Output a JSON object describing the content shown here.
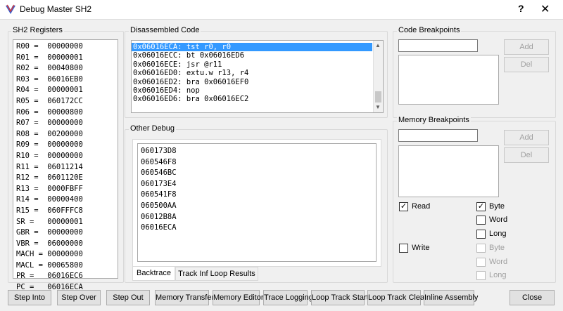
{
  "window": {
    "title": "Debug Master SH2",
    "help": "?",
    "close": "✕"
  },
  "registers": {
    "label": "SH2 Registers",
    "items": [
      "R00 =  00000000",
      "R01 =  00000001",
      "R02 =  00040800",
      "R03 =  06016EB0",
      "R04 =  00000001",
      "R05 =  060172CC",
      "R06 =  00000800",
      "R07 =  00000000",
      "R08 =  00200000",
      "R09 =  00000000",
      "R10 =  00000000",
      "R11 =  06011214",
      "R12 =  0601120E",
      "R13 =  0000FBFF",
      "R14 =  00000400",
      "R15 =  060FFFC8",
      "SR =   00000001",
      "GBR =  00000000",
      "VBR =  06000000",
      "MACH = 00000000",
      "MACL = 00065800",
      "PR =   06016EC6",
      "PC =   06016ECA"
    ]
  },
  "disassembly": {
    "label": "Disassembled Code",
    "lines": [
      "0x06016ECA: tst r0, r0",
      "0x06016ECC: bt 0x06016ED6",
      "0x06016ECE: jsr @r11",
      "0x06016ED0: extu.w r13, r4",
      "0x06016ED2: bra 0x06016EF0",
      "0x06016ED4: nop",
      "0x06016ED6: bra 0x06016EC2"
    ],
    "selected_index": 0
  },
  "code_breakpoints": {
    "label": "Code Breakpoints",
    "input_value": "",
    "add": "Add",
    "del": "Del"
  },
  "memory_breakpoints": {
    "label": "Memory Breakpoints",
    "input_value": "",
    "add": "Add",
    "del": "Del",
    "read": {
      "label": "Read",
      "checked": true
    },
    "write": {
      "label": "Write",
      "checked": false
    },
    "byte": {
      "label": "Byte",
      "checked": true
    },
    "word": {
      "label": "Word",
      "checked": false
    },
    "long": {
      "label": "Long",
      "checked": false
    },
    "byte2": {
      "label": "Byte",
      "checked": false
    },
    "word2": {
      "label": "Word",
      "checked": false
    },
    "long2": {
      "label": "Long",
      "checked": false
    }
  },
  "other_debug": {
    "label": "Other Debug",
    "backtrace": [
      "060173D8",
      "060546F8",
      "060546BC",
      "060173E4",
      "060541F8",
      "060500AA",
      "06012B8A",
      "06016ECA"
    ],
    "tabs": [
      "Backtrace",
      "Track Inf Loop Results"
    ]
  },
  "buttons": {
    "step_into": "Step Into",
    "step_over": "Step Over",
    "step_out": "Step Out",
    "memory_transfer": "Memory Transfer",
    "memory_editor": "Memory Editor",
    "trace_logging": "Trace Logging",
    "loop_track_start": "Loop Track Start",
    "loop_track_clear": "Loop Track Clear",
    "inline_assembly": "Inline Assembly",
    "close": "Close"
  },
  "colors": {
    "selection": "#3399ff",
    "window_bg": "#f0f0f0"
  }
}
